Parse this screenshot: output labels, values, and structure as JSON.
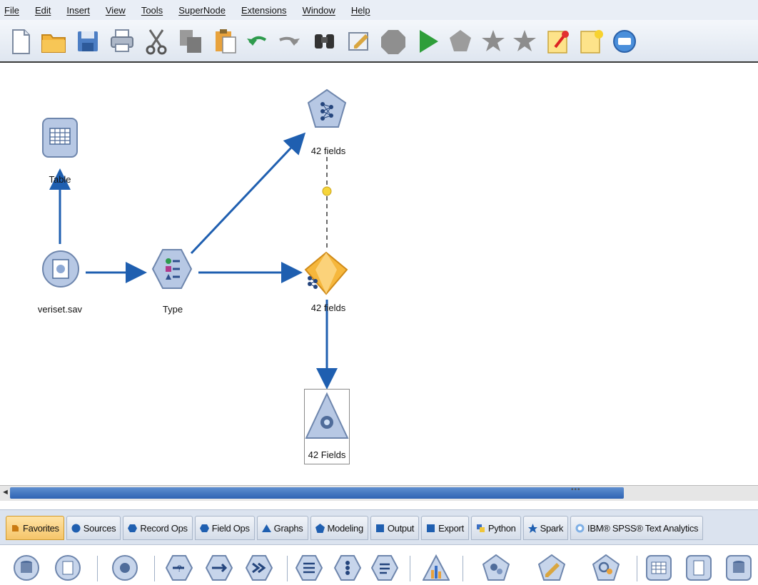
{
  "menu": [
    "File",
    "Edit",
    "Insert",
    "View",
    "Tools",
    "SuperNode",
    "Extensions",
    "Window",
    "Help"
  ],
  "toolbar_icons": [
    "new-file-icon",
    "open-folder-icon",
    "save-icon",
    "print-icon",
    "cut-icon",
    "copy-icon",
    "paste-icon",
    "undo-icon",
    "redo-icon",
    "find-binoculars-icon",
    "edit-stream-icon",
    "stop-icon",
    "run-icon",
    "run-selection-icon",
    "preview-star-icon",
    "favorite-star-icon",
    "annotation-pin-icon",
    "comment-icon",
    "repository-icon"
  ],
  "canvas": {
    "nodes": {
      "table": "Table",
      "source": "veriset.sav",
      "type": "Type",
      "model_top": "42 fields",
      "model_mid": "42 fields",
      "analysis": "42 Fields"
    }
  },
  "palette_tabs": [
    "Favorites",
    "Sources",
    "Record Ops",
    "Field Ops",
    "Graphs",
    "Modeling",
    "Output",
    "Export",
    "Python",
    "Spark",
    "IBM® SPSS® Text Analytics"
  ],
  "palette_nodes": [
    "database-icon",
    "var-file-icon",
    "type-node-icon",
    "select-icon",
    "sample-icon",
    "merge-icon",
    "filler-icon",
    "derive-icon",
    "reclassify-icon",
    "histogram-icon",
    "model-icon",
    "edit-model-icon",
    "auto-model-icon",
    "table-icon",
    "analysis-icon",
    "export-db-icon"
  ],
  "colors": {
    "link": "#1f5fb0",
    "menubar": "#e9eef6",
    "active_tab": "#f5c56a"
  }
}
